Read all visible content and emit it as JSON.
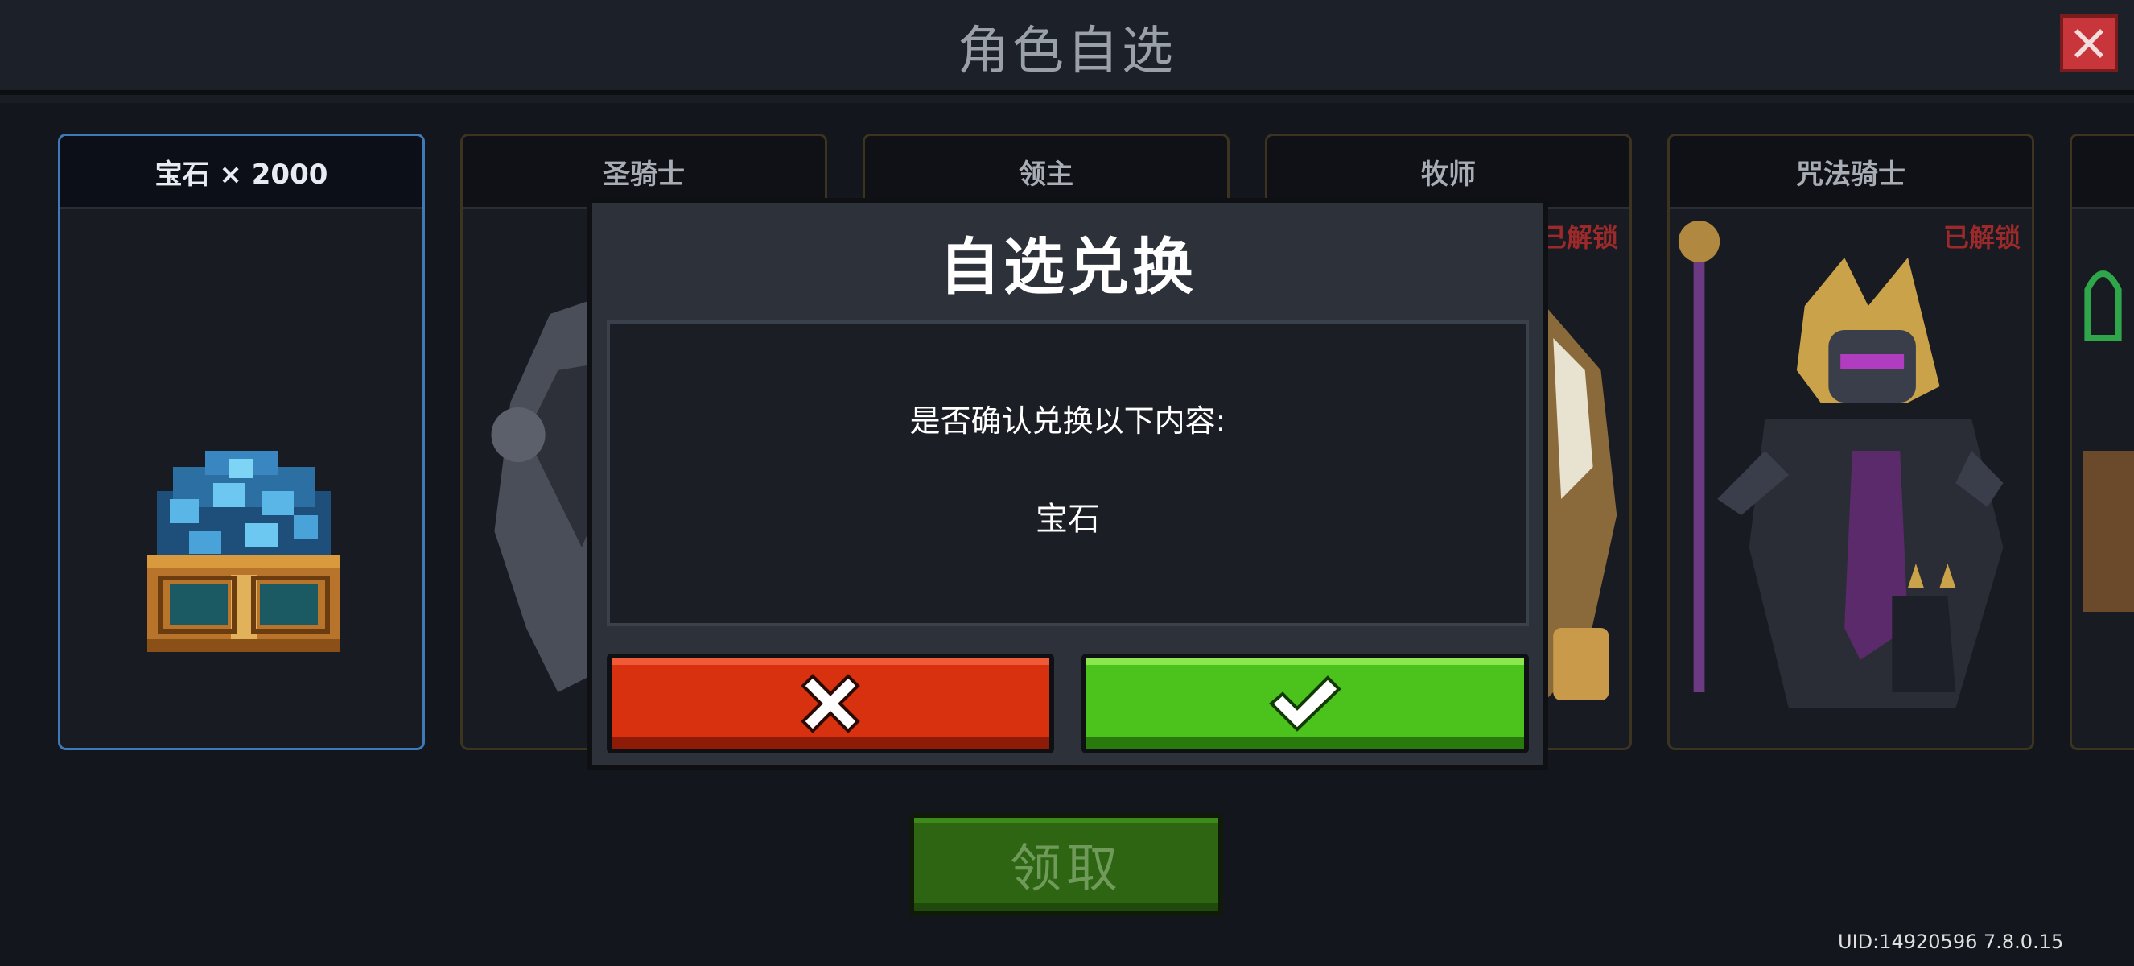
{
  "header": {
    "title": "角色自选"
  },
  "cards": [
    {
      "name": "宝石 × 2000",
      "selected": true,
      "status": ""
    },
    {
      "name": "圣骑士",
      "selected": false,
      "status": ""
    },
    {
      "name": "领主",
      "selected": false,
      "status": ""
    },
    {
      "name": "牧师",
      "selected": false,
      "status": "已解锁"
    },
    {
      "name": "咒法骑士",
      "selected": false,
      "status": "已解锁"
    }
  ],
  "dialog": {
    "title": "自选兑换",
    "message": "是否确认兑换以下内容:",
    "item": "宝石",
    "cancel_icon": "x-icon",
    "confirm_icon": "check-icon"
  },
  "claim_button": {
    "label": "领取"
  },
  "footer": {
    "uid": "UID:14920596 7.8.0.15"
  },
  "colors": {
    "cancel": "#d83110",
    "confirm": "#4cc21c",
    "claim": "#2e6512",
    "selected_border": "#3f7ab8",
    "unlock_text": "#9c2a2a"
  }
}
